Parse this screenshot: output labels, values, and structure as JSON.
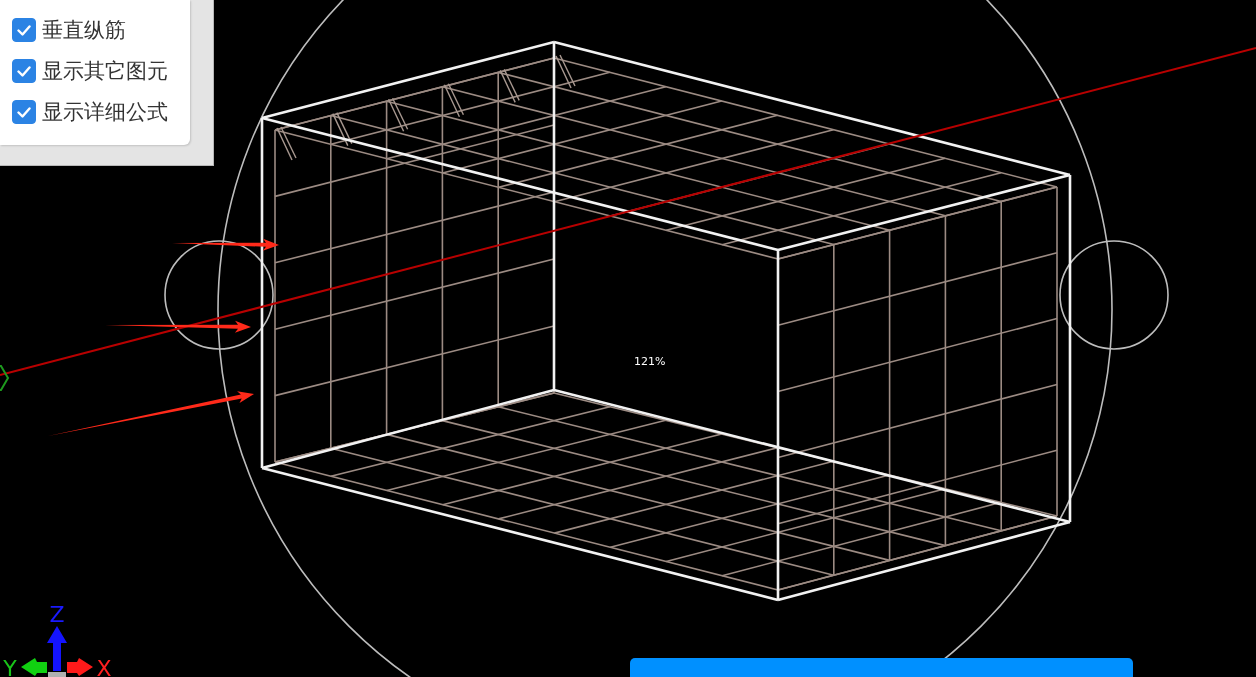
{
  "options_panel": {
    "items": [
      {
        "label": "垂直纵筋",
        "checked": true
      },
      {
        "label": "显示其它图元",
        "checked": true
      },
      {
        "label": "显示详细公式",
        "checked": true
      }
    ]
  },
  "viewport": {
    "zoom_label": "121%"
  },
  "axis_triad": {
    "x_label": "X",
    "y_label": "Y",
    "z_label": "Z"
  }
}
